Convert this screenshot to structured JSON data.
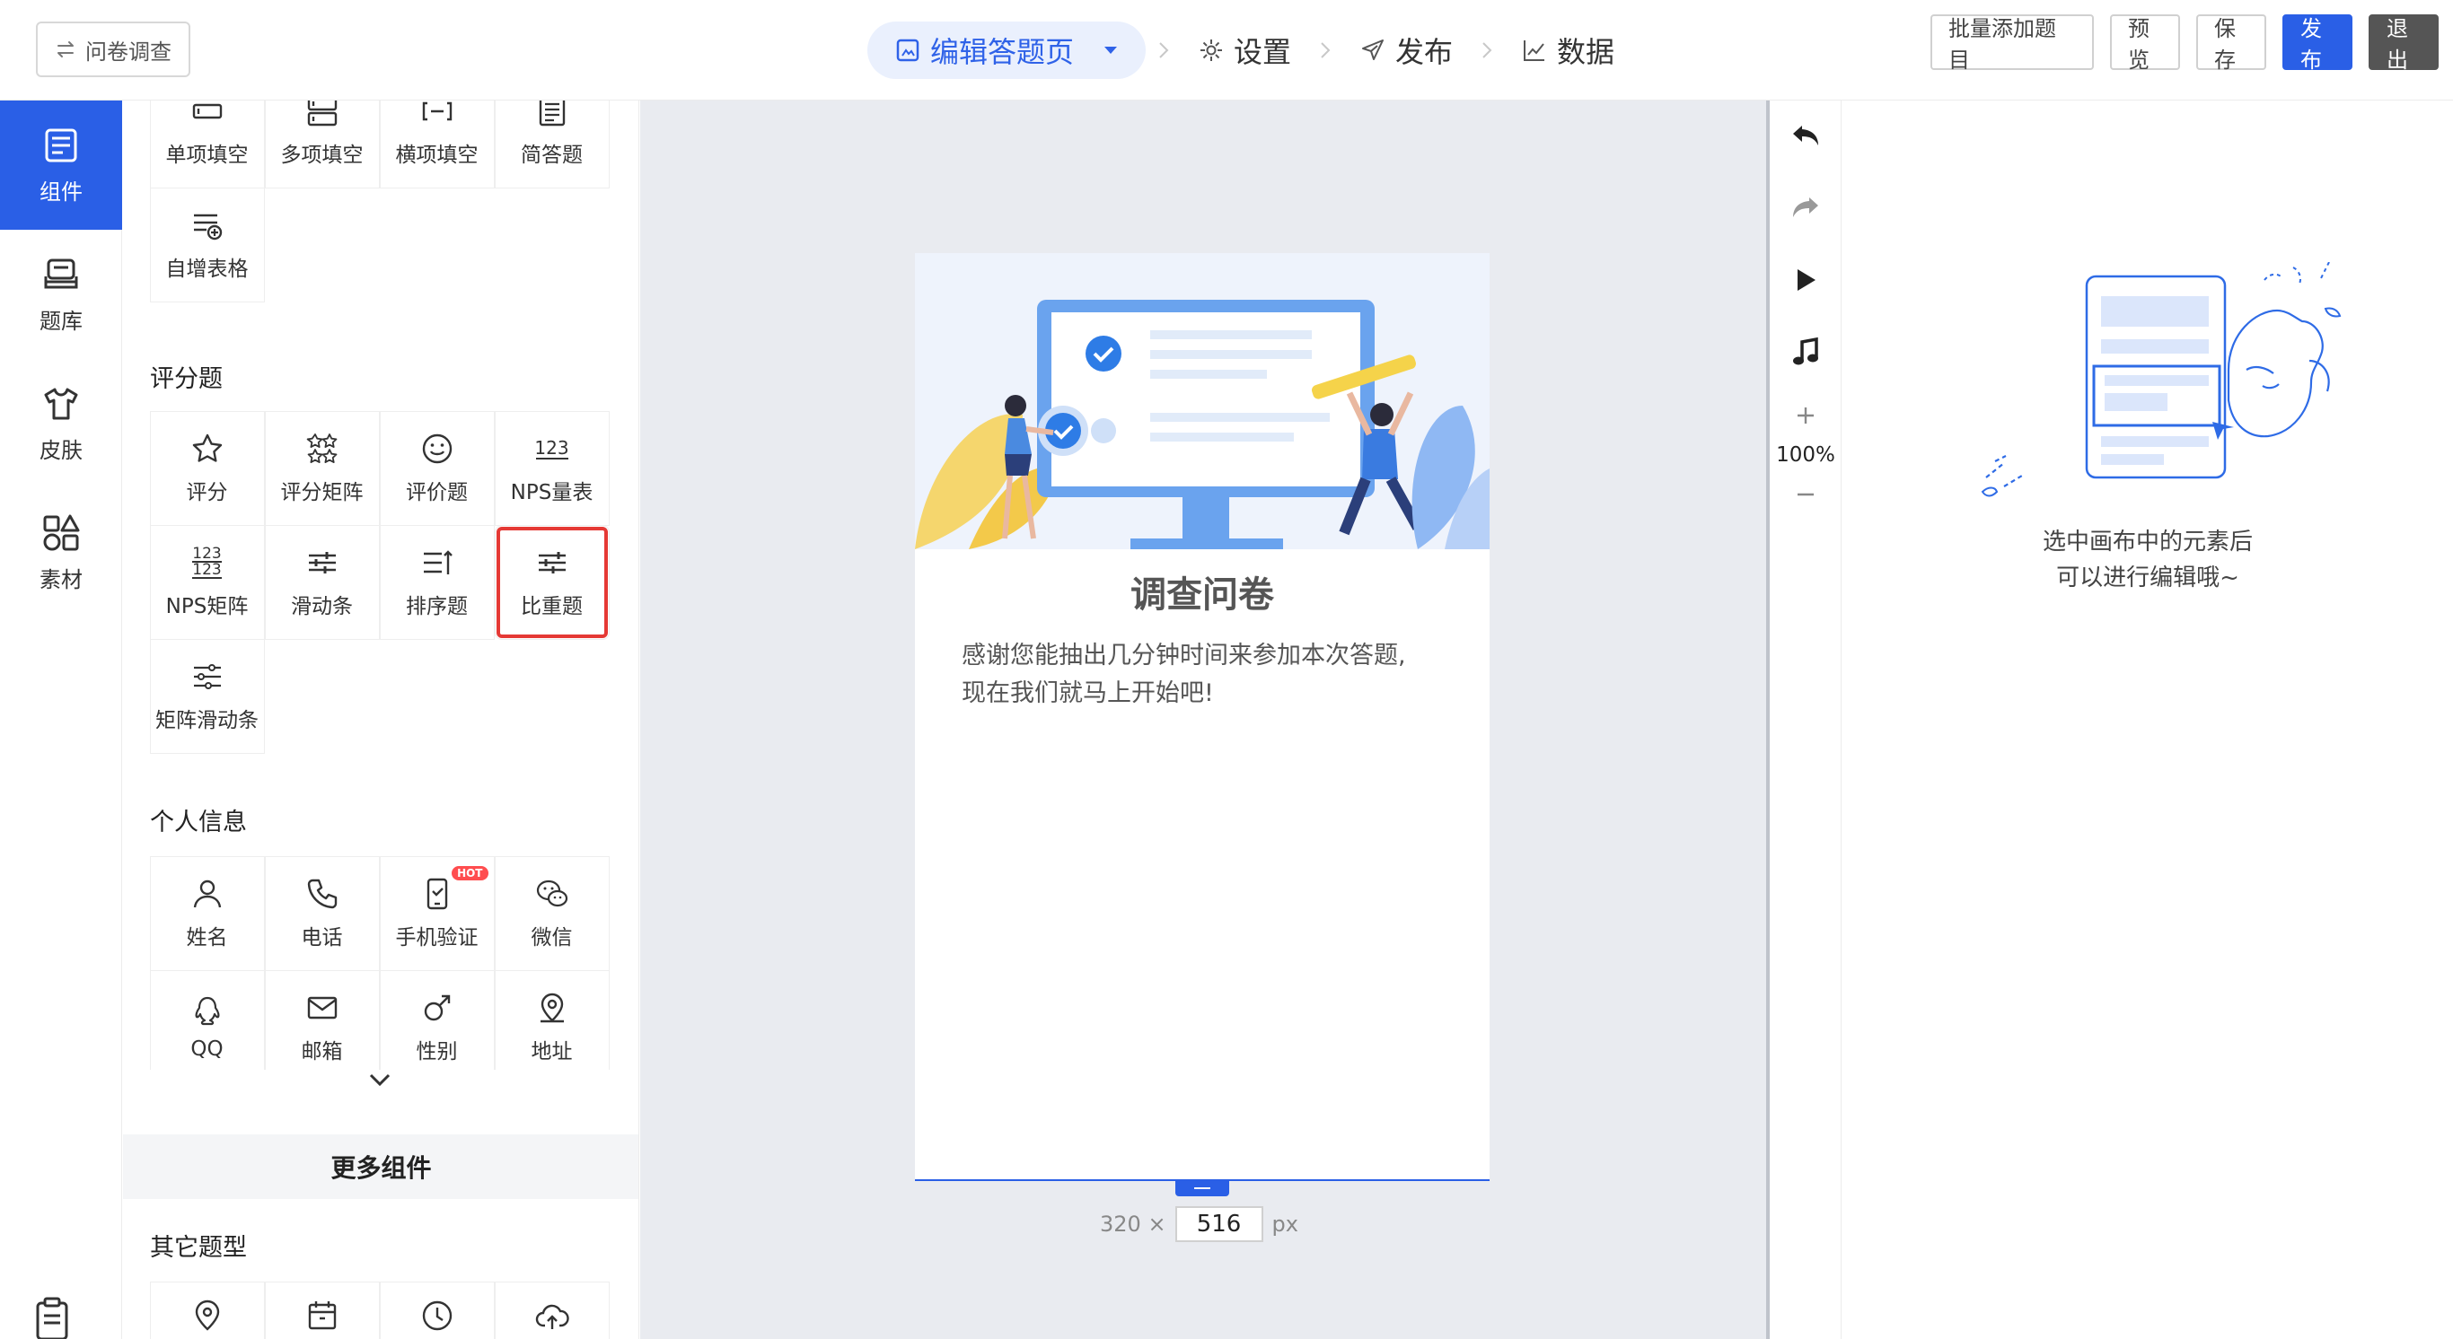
{
  "topbar": {
    "back_label": "问卷调查",
    "steps": [
      {
        "label": "编辑答题页",
        "icon": "edit-image-icon"
      },
      {
        "label": "设置",
        "icon": "gear-icon"
      },
      {
        "label": "发布",
        "icon": "send-icon"
      },
      {
        "label": "数据",
        "icon": "chart-line-icon"
      }
    ],
    "actions": {
      "batch_add": "批量添加题目",
      "preview": "预览",
      "save": "保存",
      "publish": "发布",
      "exit": "退出"
    },
    "accent_color": "#2a5fe6"
  },
  "leftnav": {
    "items": [
      {
        "label": "组件",
        "icon": "component-list-icon"
      },
      {
        "label": "题库",
        "icon": "question-bank-icon"
      },
      {
        "label": "皮肤",
        "icon": "tshirt-icon"
      },
      {
        "label": "素材",
        "icon": "shapes-icon"
      }
    ]
  },
  "panel": {
    "fill_items": [
      {
        "label": "单项填空",
        "icon": "single-fill-icon"
      },
      {
        "label": "多项填空",
        "icon": "multi-fill-icon"
      },
      {
        "label": "横项填空",
        "icon": "horizontal-fill-icon"
      },
      {
        "label": "简答题",
        "icon": "short-answer-icon"
      },
      {
        "label": "自增表格",
        "icon": "add-table-icon"
      }
    ],
    "rating_title": "评分题",
    "rating_items": [
      {
        "label": "评分",
        "icon": "star-icon"
      },
      {
        "label": "评分矩阵",
        "icon": "star-matrix-icon"
      },
      {
        "label": "评价题",
        "icon": "smile-icon"
      },
      {
        "label": "NPS量表",
        "icon": "nps-scale-icon"
      },
      {
        "label": "NPS矩阵",
        "icon": "nps-matrix-icon"
      },
      {
        "label": "滑动条",
        "icon": "slider-icon"
      },
      {
        "label": "排序题",
        "icon": "sort-icon"
      },
      {
        "label": "比重题",
        "icon": "proportion-icon"
      },
      {
        "label": "矩阵滑动条",
        "icon": "matrix-slider-icon"
      }
    ],
    "nps_glyph": "123",
    "personal_title": "个人信息",
    "personal_items": [
      {
        "label": "姓名",
        "icon": "person-icon"
      },
      {
        "label": "电话",
        "icon": "phone-icon"
      },
      {
        "label": "手机验证",
        "icon": "mobile-verify-icon",
        "badge": "HOT"
      },
      {
        "label": "微信",
        "icon": "wechat-icon"
      },
      {
        "label": "QQ",
        "icon": "qq-icon"
      },
      {
        "label": "邮箱",
        "icon": "mail-icon"
      },
      {
        "label": "性别",
        "icon": "gender-icon"
      },
      {
        "label": "地址",
        "icon": "location-icon"
      }
    ],
    "more_label": "更多组件",
    "other_title": "其它题型",
    "other_items": [
      {
        "icon": "pin-icon"
      },
      {
        "icon": "calendar-icon"
      },
      {
        "icon": "clock-icon"
      },
      {
        "icon": "upload-cloud-icon"
      }
    ]
  },
  "canvas": {
    "title": "调查问卷",
    "description_line1": "感谢您能抽出几分钟时间来参加本次答题,",
    "description_line2": "现在我们就马上开始吧!",
    "width_label": "320 ×",
    "height_value": "516",
    "unit": "px"
  },
  "tools": {
    "zoom": "100%"
  },
  "props": {
    "empty_line1": "选中画布中的元素后",
    "empty_line2": "可以进行编辑哦~"
  }
}
